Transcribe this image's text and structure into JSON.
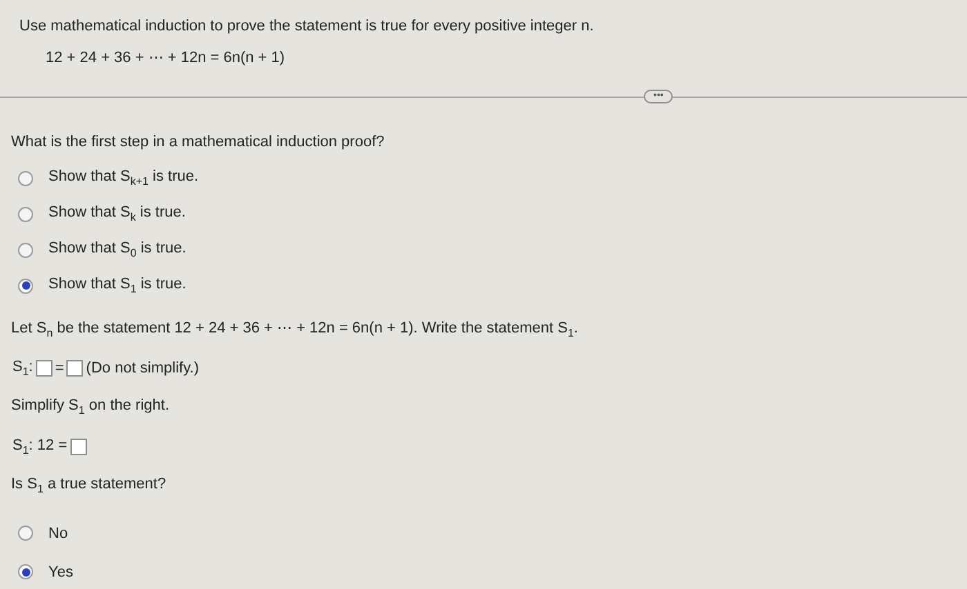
{
  "problem": {
    "instruction": "Use mathematical induction to prove the statement is true for every positive integer n.",
    "equation": "12 + 24 + 36 + ⋯ + 12n = 6n(n + 1)",
    "more_button": "•••"
  },
  "question_1": {
    "prompt": "What is the first step in a mathematical induction proof?",
    "options": [
      {
        "label": "Show that S$_{k+1}$ is true.",
        "selected": false
      },
      {
        "label": "Show that S$_{k}$ is true.",
        "selected": false
      },
      {
        "label": "Show that S$_{0}$ is true.",
        "selected": false
      },
      {
        "label": "Show that S$_{1}$ is true.",
        "selected": true
      }
    ]
  },
  "lines": [
    {
      "kind": "paragraph",
      "parts": [
        {
          "kind": "text",
          "text": "Let S$_{n}$ be the statement 12 + 24 + 36 + ⋯ + 12n = 6n(n + 1). Write the statement S$_{1}$."
        }
      ]
    },
    {
      "kind": "answer_row",
      "parts": [
        {
          "kind": "text",
          "text": "S$_{1}$:"
        },
        {
          "kind": "box"
        },
        {
          "kind": "text",
          "text": "="
        },
        {
          "kind": "box"
        },
        {
          "kind": "text",
          "text": "(Do not simplify.)"
        }
      ]
    },
    {
      "kind": "paragraph",
      "parts": [
        {
          "kind": "text",
          "text": "Simplify S$_{1}$ on the right."
        }
      ]
    },
    {
      "kind": "answer_row",
      "parts": [
        {
          "kind": "text",
          "text": "S$_{1}$: 12 ="
        },
        {
          "kind": "box"
        }
      ]
    },
    {
      "kind": "paragraph",
      "parts": [
        {
          "kind": "text",
          "text": "Is S$_{1}$ a true statement?"
        }
      ]
    }
  ],
  "question_2": {
    "options": [
      {
        "label": "No",
        "selected": false
      },
      {
        "label": "Yes",
        "selected": true
      }
    ]
  }
}
